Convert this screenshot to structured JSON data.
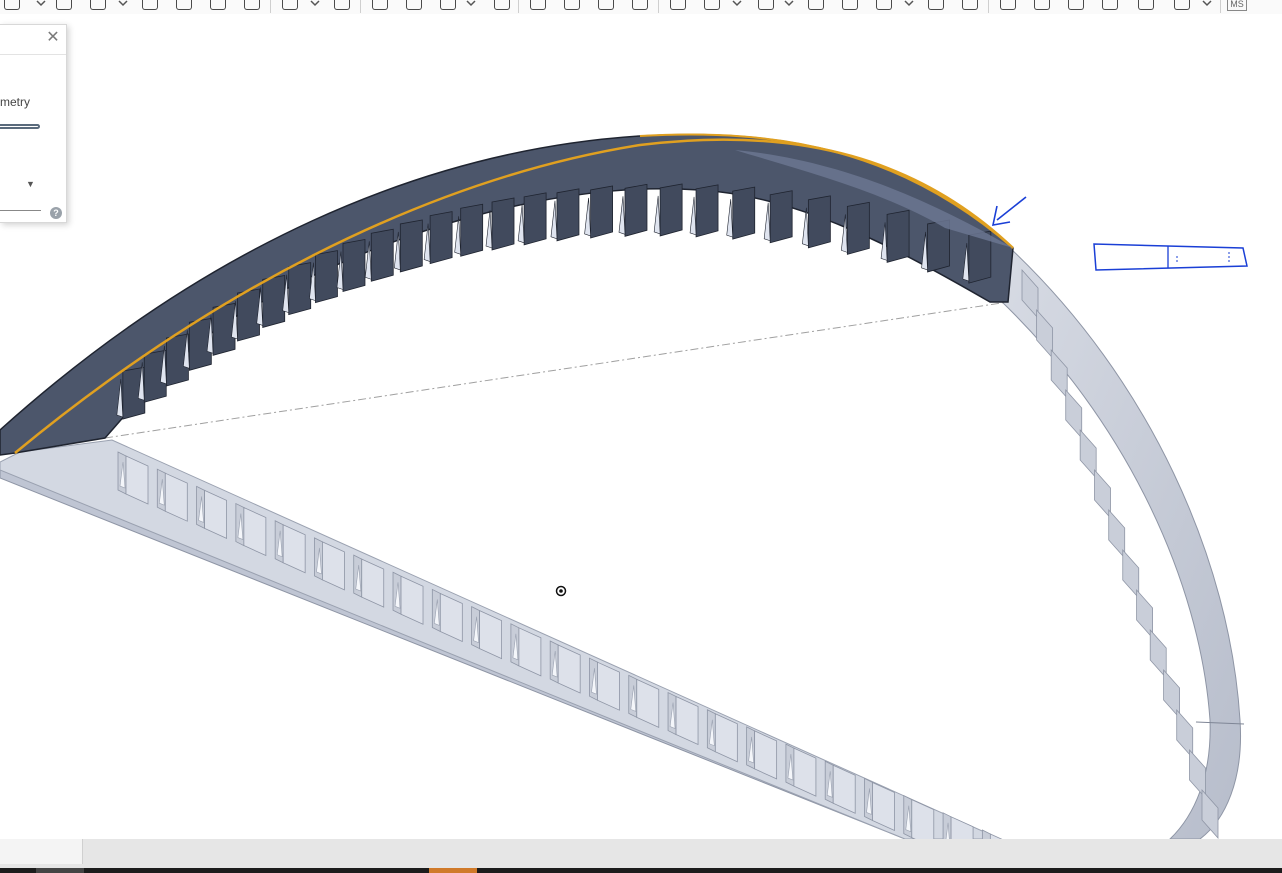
{
  "dialog": {
    "close_icon": "close-icon",
    "option_label_fragment": "metry",
    "help_label": "?"
  },
  "toolbar": {
    "icons": [
      "sketch-icon",
      "extrude-icon",
      "revolve-icon",
      "sweep-icon",
      "loft-icon",
      "thicken-icon",
      "fillet-icon",
      "chamfer-icon",
      "draft-icon",
      "shell-icon",
      "hole-icon",
      "boolean-icon",
      "split-icon",
      "transform-icon",
      "pattern-icon",
      "mirror-icon",
      "helix-icon",
      "fit-spline-icon",
      "variable-icon",
      "derived-icon",
      "tag-icon",
      "sheet-metal-icon",
      "frame-icon",
      "weldment-icon",
      "part-studio-icon",
      "assembly-icon",
      "ms-icon"
    ],
    "ms_label": "MS"
  },
  "viewport": {
    "model": "curved-ribbed-frame",
    "annotation_color": "#1a3fd6",
    "selection_color": "#e0a020",
    "selected_face_color": "#4f5a70",
    "unselected_face_color": "#c3c9d6"
  },
  "colors": {
    "taskbar_accent": "#d07a2a"
  }
}
